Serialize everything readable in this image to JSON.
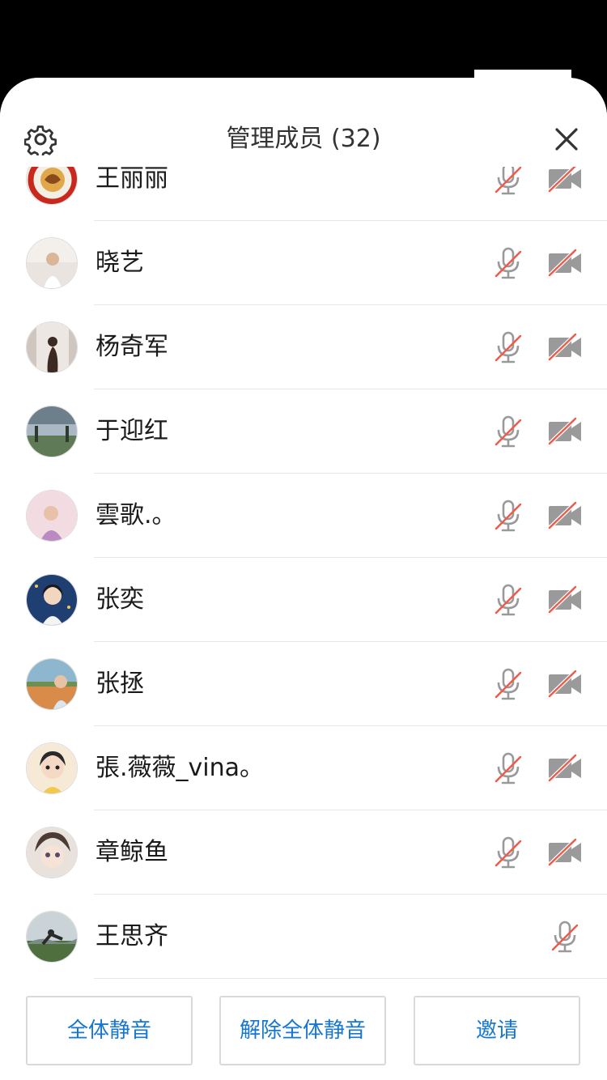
{
  "header": {
    "title": "管理成员 (32)",
    "settings_icon": "gear-icon",
    "close_icon": "close-icon"
  },
  "members": [
    {
      "name": "王丽丽",
      "mic": "muted",
      "camera": "off"
    },
    {
      "name": "晓艺",
      "mic": "muted",
      "camera": "off"
    },
    {
      "name": "杨奇军",
      "mic": "muted",
      "camera": "off"
    },
    {
      "name": "于迎红",
      "mic": "muted",
      "camera": "off"
    },
    {
      "name": "雲歌.。",
      "mic": "muted",
      "camera": "off"
    },
    {
      "name": "张奕",
      "mic": "muted",
      "camera": "off"
    },
    {
      "name": "张拯",
      "mic": "muted",
      "camera": "off"
    },
    {
      "name": "張.薇薇_vina。",
      "mic": "muted",
      "camera": "off"
    },
    {
      "name": "章鲸鱼",
      "mic": "muted",
      "camera": "off"
    },
    {
      "name": "王思齐",
      "mic": "muted"
    }
  ],
  "footer": {
    "mute_all_label": "全体静音",
    "unmute_all_label": "解除全体静音",
    "invite_label": "邀请"
  },
  "colors": {
    "accent": "#1677d2",
    "icon_gray": "#9a9a9a",
    "strike_red": "#f05a4a",
    "divider": "#e6e6e6"
  }
}
